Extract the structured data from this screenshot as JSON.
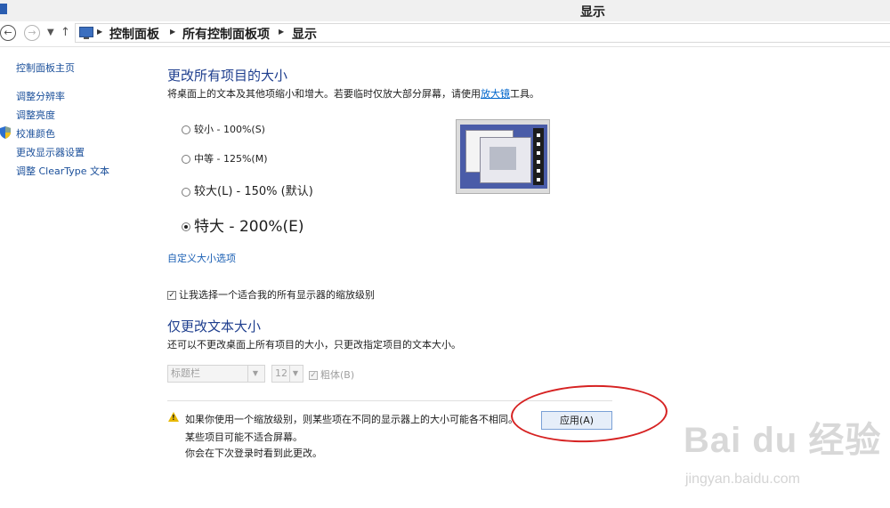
{
  "window": {
    "title": "显示"
  },
  "address": {
    "crumbs": [
      "控制面板",
      "所有控制面板项",
      "显示"
    ]
  },
  "sidebar": {
    "home": "控制面板主页",
    "items": [
      {
        "label": "调整分辨率"
      },
      {
        "label": "调整亮度"
      },
      {
        "label": "校准颜色"
      },
      {
        "label": "更改显示器设置"
      },
      {
        "label": "调整 ClearType 文本"
      }
    ]
  },
  "size_section": {
    "heading": "更改所有项目的大小",
    "desc_before": "将桌面上的文本及其他项缩小和增大。若要临时仅放大部分屏幕，请使用",
    "desc_link": "放大镜",
    "desc_after": "工具。",
    "options": [
      {
        "label": "较小 - 100%(S)",
        "selected": false
      },
      {
        "label": "中等 - 125%(M)",
        "selected": false
      },
      {
        "label": "较大(L) - 150% (默认)",
        "selected": false
      },
      {
        "label": "特大 - 200%(E)",
        "selected": true
      }
    ],
    "custom_link": "自定义大小选项",
    "checkbox_label": "让我选择一个适合我的所有显示器的缩放级别",
    "checkbox_checked": true
  },
  "text_section": {
    "heading": "仅更改文本大小",
    "desc": "还可以不更改桌面上所有项目的大小，只更改指定项目的文本大小。",
    "item_select": "标题栏",
    "size_select": "12",
    "bold_label": "粗体(B)"
  },
  "warning": {
    "lines": [
      "如果你使用一个缩放级别，则某些项在不同的显示器上的大小可能各不相同。",
      "某些项目可能不适合屏幕。",
      "你会在下次登录时看到此更改。"
    ]
  },
  "apply_button": "应用(A)",
  "watermark": {
    "brand": "Bai du 经验",
    "url": "jingyan.baidu.com"
  },
  "colors": {
    "link": "#1a4f9a",
    "heading": "#1e3e8e",
    "highlight": "#d62222"
  }
}
